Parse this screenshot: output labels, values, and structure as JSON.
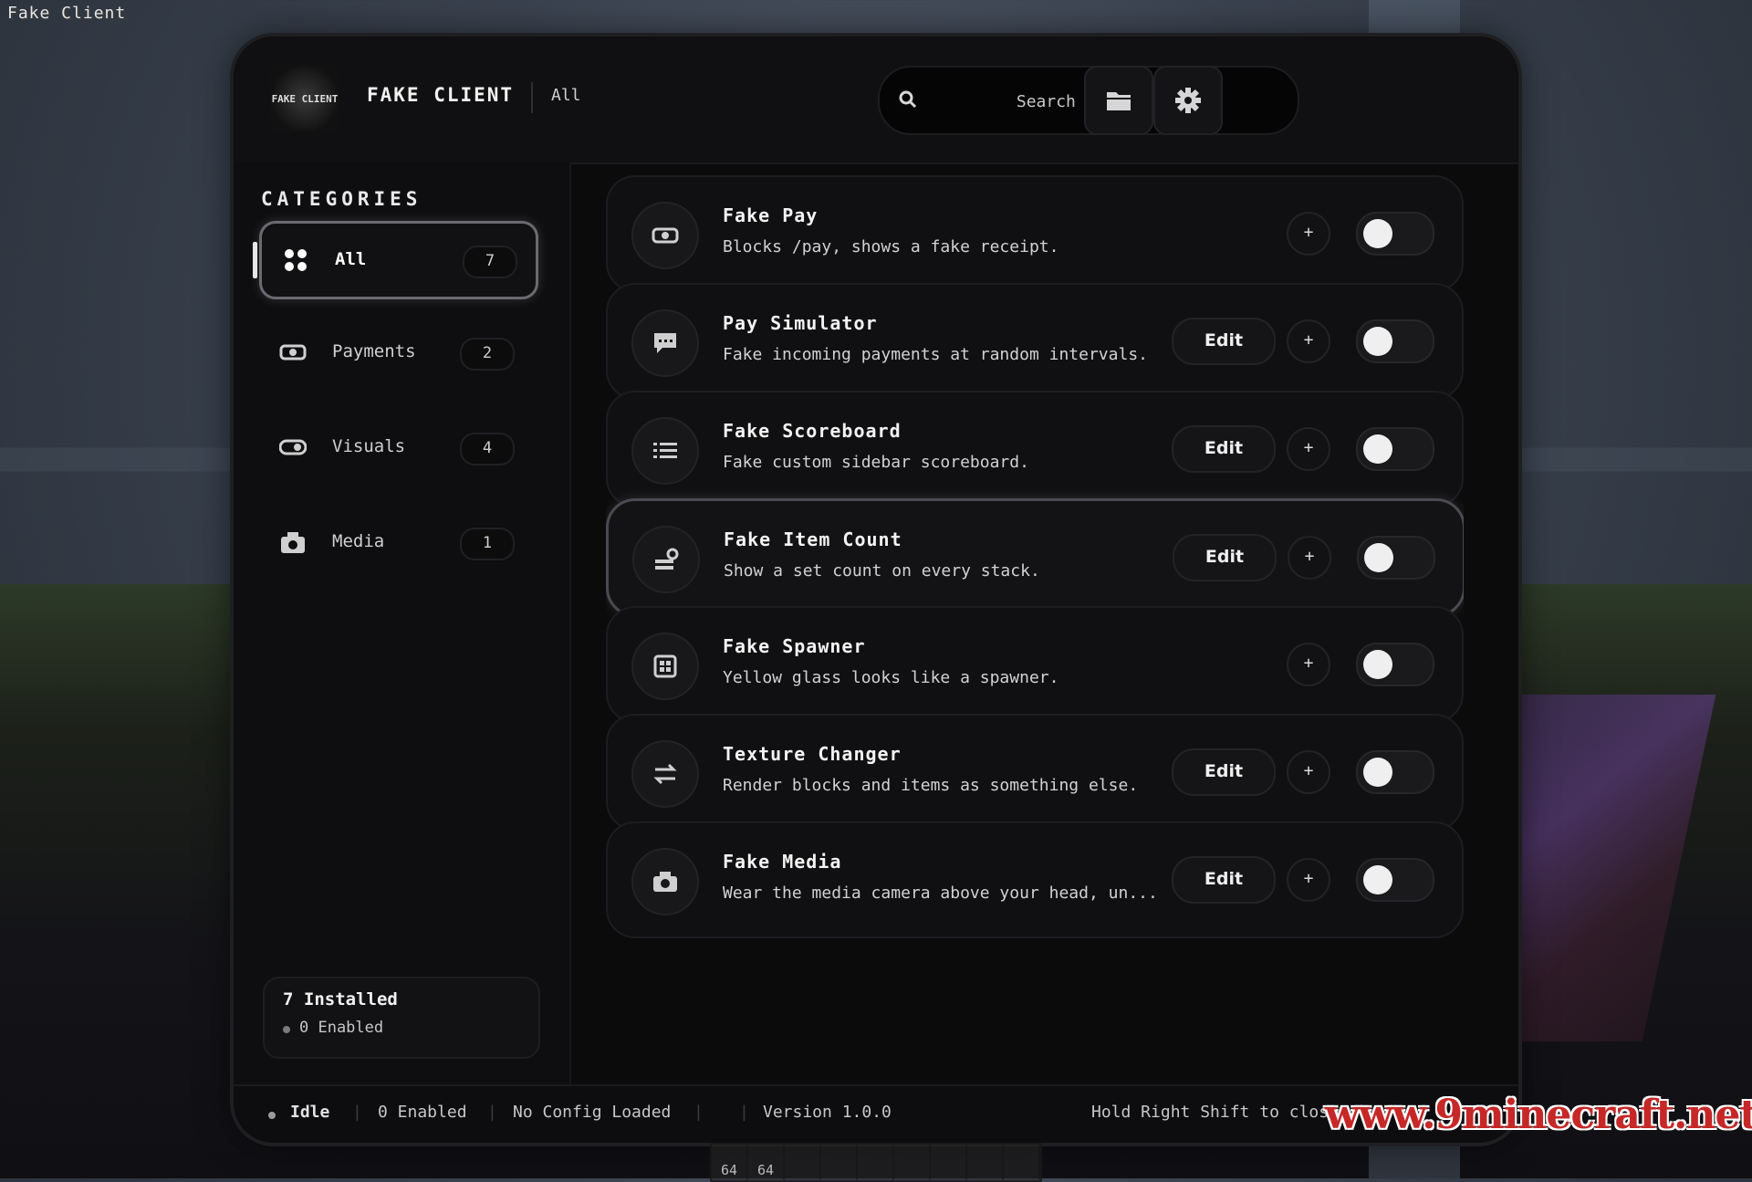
{
  "window_title": "Fake Client",
  "header": {
    "logo_text": "FAKE CLIENT",
    "brand": "FAKE CLIENT",
    "breadcrumb": "All",
    "search_placeholder": "Search modules...",
    "folder_icon": "folder-icon",
    "settings_icon": "gear-icon"
  },
  "sidebar": {
    "title": "CATEGORIES",
    "categories": [
      {
        "label": "All",
        "count": "7",
        "icon": "grid-icon",
        "active": true
      },
      {
        "label": "Payments",
        "count": "2",
        "icon": "cash-icon",
        "active": false
      },
      {
        "label": "Visuals",
        "count": "4",
        "icon": "toggle-icon",
        "active": false
      },
      {
        "label": "Media",
        "count": "1",
        "icon": "camera-icon",
        "active": false
      }
    ],
    "summary": {
      "installed": "7 Installed",
      "enabled": "0 Enabled"
    }
  },
  "modules": [
    {
      "name": "Fake Pay",
      "desc": "Blocks /pay, shows a fake receipt.",
      "has_edit": false,
      "icon": "cash-icon"
    },
    {
      "name": "Pay Simulator",
      "desc": "Fake incoming payments at random intervals.",
      "has_edit": true,
      "icon": "chat-icon"
    },
    {
      "name": "Fake Scoreboard",
      "desc": "Fake custom sidebar scoreboard.",
      "has_edit": true,
      "icon": "list-icon"
    },
    {
      "name": "Fake Item Count",
      "desc": "Show a set count on every stack.",
      "has_edit": true,
      "icon": "stack-icon"
    },
    {
      "name": "Fake Spawner",
      "desc": "Yellow glass looks like a spawner.",
      "has_edit": false,
      "icon": "cage-icon"
    },
    {
      "name": "Texture Changer",
      "desc": "Render blocks and items as something else.",
      "has_edit": true,
      "icon": "swap-icon"
    },
    {
      "name": "Fake Media",
      "desc": "Wear the media camera above your head, un...",
      "has_edit": true,
      "icon": "camera-icon"
    }
  ],
  "labels": {
    "edit": "Edit",
    "plus": "+"
  },
  "footer": {
    "status": "Idle",
    "enabled": "0 Enabled",
    "config": "No Config Loaded",
    "version": "Version 1.0.0",
    "hint": "Hold Right Shift to close"
  },
  "hotbar": {
    "slot1": "64",
    "slot2": "64"
  },
  "watermark": "www.9minecraft.net",
  "colors": {
    "panel": "#0b0b0c",
    "card": "#101012",
    "text": "#e7e7e7",
    "watermark": "#c62828"
  }
}
